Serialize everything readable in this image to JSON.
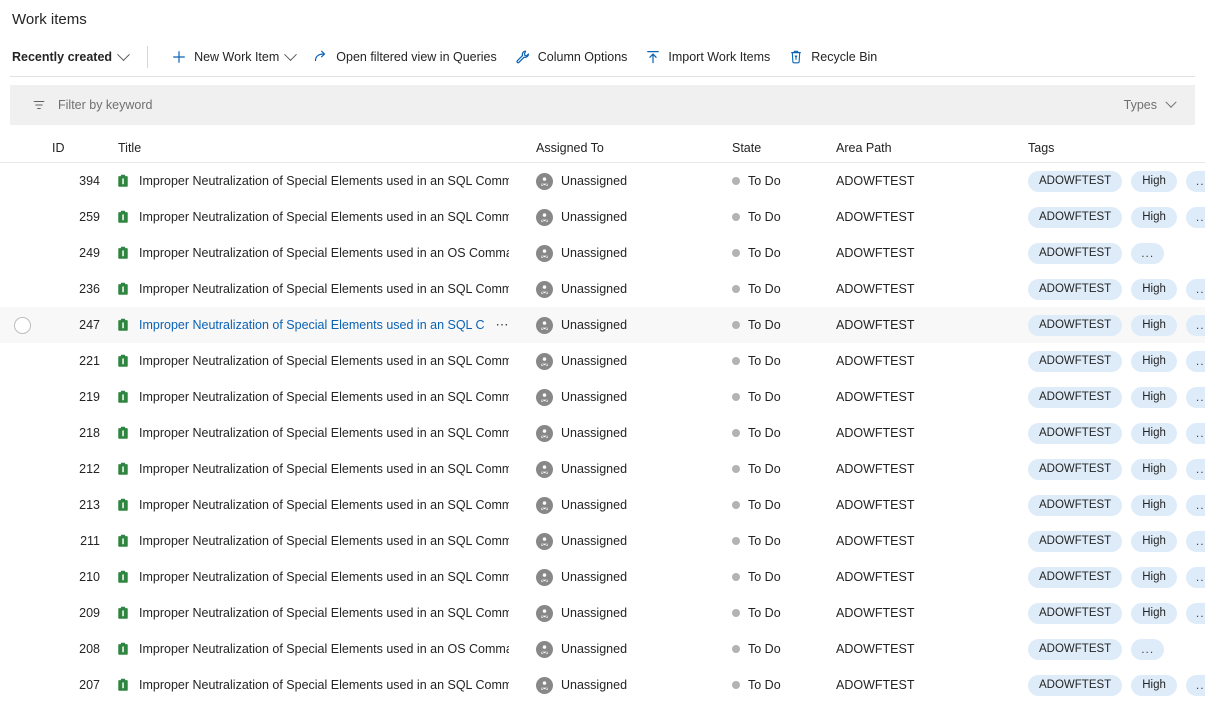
{
  "page": {
    "title": "Work items"
  },
  "toolbar": {
    "pivot_label": "Recently created",
    "items": [
      {
        "label": "New Work Item",
        "icon": "plus-icon",
        "has_chevron": true
      },
      {
        "label": "Open filtered view in Queries",
        "icon": "open-external-icon",
        "has_chevron": false
      },
      {
        "label": "Column Options",
        "icon": "wrench-icon",
        "has_chevron": false
      },
      {
        "label": "Import Work Items",
        "icon": "upload-icon",
        "has_chevron": false
      },
      {
        "label": "Recycle Bin",
        "icon": "recycle-bin-icon",
        "has_chevron": false
      }
    ]
  },
  "filter": {
    "placeholder": "Filter by keyword",
    "icon": "filter-icon",
    "types_label": "Types"
  },
  "table": {
    "columns": [
      "ID",
      "Title",
      "Assigned To",
      "State",
      "Area Path",
      "Tags"
    ],
    "rows": [
      {
        "id": "394",
        "title": "Improper Neutralization of Special Elements used in an SQL Comm",
        "assigned_to": "Unassigned",
        "state": "To Do",
        "area_path": "ADOWFTEST",
        "tags": [
          "ADOWFTEST",
          "High",
          "..."
        ],
        "hovered": false
      },
      {
        "id": "259",
        "title": "Improper Neutralization of Special Elements used in an SQL Comm",
        "assigned_to": "Unassigned",
        "state": "To Do",
        "area_path": "ADOWFTEST",
        "tags": [
          "ADOWFTEST",
          "High",
          "..."
        ],
        "hovered": false
      },
      {
        "id": "249",
        "title": "Improper Neutralization of Special Elements used in an OS Comma",
        "assigned_to": "Unassigned",
        "state": "To Do",
        "area_path": "ADOWFTEST",
        "tags": [
          "ADOWFTEST",
          "..."
        ],
        "hovered": false
      },
      {
        "id": "236",
        "title": "Improper Neutralization of Special Elements used in an SQL Comm",
        "assigned_to": "Unassigned",
        "state": "To Do",
        "area_path": "ADOWFTEST",
        "tags": [
          "ADOWFTEST",
          "High",
          "..."
        ],
        "hovered": false
      },
      {
        "id": "247",
        "title": "Improper Neutralization of Special Elements used in an SQL C",
        "assigned_to": "Unassigned",
        "state": "To Do",
        "area_path": "ADOWFTEST",
        "tags": [
          "ADOWFTEST",
          "High",
          "..."
        ],
        "hovered": true
      },
      {
        "id": "221",
        "title": "Improper Neutralization of Special Elements used in an SQL Comm",
        "assigned_to": "Unassigned",
        "state": "To Do",
        "area_path": "ADOWFTEST",
        "tags": [
          "ADOWFTEST",
          "High",
          "..."
        ],
        "hovered": false
      },
      {
        "id": "219",
        "title": "Improper Neutralization of Special Elements used in an SQL Comm",
        "assigned_to": "Unassigned",
        "state": "To Do",
        "area_path": "ADOWFTEST",
        "tags": [
          "ADOWFTEST",
          "High",
          "..."
        ],
        "hovered": false
      },
      {
        "id": "218",
        "title": "Improper Neutralization of Special Elements used in an SQL Comm",
        "assigned_to": "Unassigned",
        "state": "To Do",
        "area_path": "ADOWFTEST",
        "tags": [
          "ADOWFTEST",
          "High",
          "..."
        ],
        "hovered": false
      },
      {
        "id": "212",
        "title": "Improper Neutralization of Special Elements used in an SQL Comm",
        "assigned_to": "Unassigned",
        "state": "To Do",
        "area_path": "ADOWFTEST",
        "tags": [
          "ADOWFTEST",
          "High",
          "..."
        ],
        "hovered": false
      },
      {
        "id": "213",
        "title": "Improper Neutralization of Special Elements used in an SQL Comm",
        "assigned_to": "Unassigned",
        "state": "To Do",
        "area_path": "ADOWFTEST",
        "tags": [
          "ADOWFTEST",
          "High",
          "..."
        ],
        "hovered": false
      },
      {
        "id": "211",
        "title": "Improper Neutralization of Special Elements used in an SQL Comm",
        "assigned_to": "Unassigned",
        "state": "To Do",
        "area_path": "ADOWFTEST",
        "tags": [
          "ADOWFTEST",
          "High",
          "..."
        ],
        "hovered": false
      },
      {
        "id": "210",
        "title": "Improper Neutralization of Special Elements used in an SQL Comm",
        "assigned_to": "Unassigned",
        "state": "To Do",
        "area_path": "ADOWFTEST",
        "tags": [
          "ADOWFTEST",
          "High",
          "..."
        ],
        "hovered": false
      },
      {
        "id": "209",
        "title": "Improper Neutralization of Special Elements used in an SQL Comm",
        "assigned_to": "Unassigned",
        "state": "To Do",
        "area_path": "ADOWFTEST",
        "tags": [
          "ADOWFTEST",
          "High",
          "..."
        ],
        "hovered": false
      },
      {
        "id": "208",
        "title": "Improper Neutralization of Special Elements used in an OS Comma",
        "assigned_to": "Unassigned",
        "state": "To Do",
        "area_path": "ADOWFTEST",
        "tags": [
          "ADOWFTEST",
          "..."
        ],
        "hovered": false
      },
      {
        "id": "207",
        "title": "Improper Neutralization of Special Elements used in an SQL Comm",
        "assigned_to": "Unassigned",
        "state": "To Do",
        "area_path": "ADOWFTEST",
        "tags": [
          "ADOWFTEST",
          "High",
          "..."
        ],
        "hovered": false
      }
    ]
  },
  "colors": {
    "accent": "#0a62b4",
    "tag_bg": "#deecf9",
    "work_item_icon": "#2e8540",
    "state_dot": "#b3b3b3"
  },
  "icons": {
    "work_item": "task-icon",
    "avatar": "person-unassigned-icon",
    "state": "state-dot-icon",
    "row_menu": "more-actions-icon",
    "row_select": "row-select-checkbox"
  }
}
